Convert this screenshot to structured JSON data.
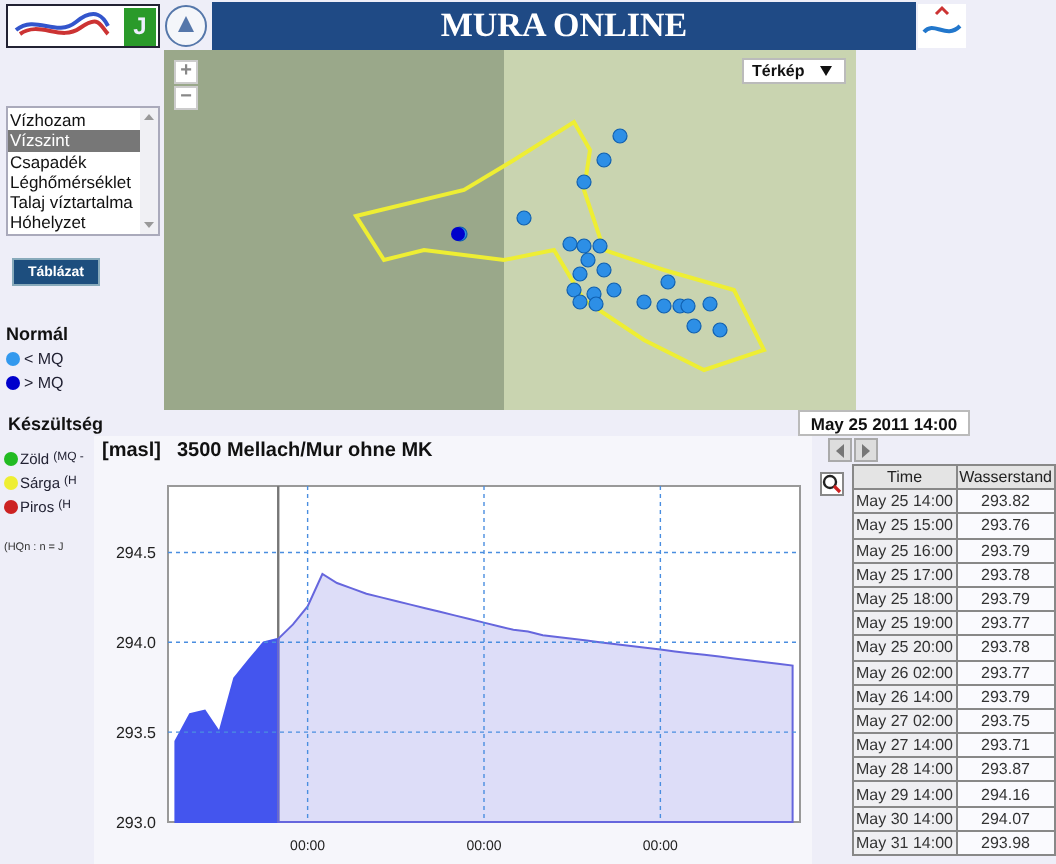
{
  "header": {
    "logo_letter": "J",
    "title": "MURA ONLINE"
  },
  "sidebar": {
    "list": [
      {
        "label": "Vízhozam",
        "selected": false
      },
      {
        "label": "Vízszint",
        "selected": true
      },
      {
        "label": "Csapadék",
        "selected": false
      },
      {
        "label": "Léghőmérséklet",
        "selected": false
      },
      {
        "label": "Talaj víztartalma",
        "selected": false
      },
      {
        "label": "Hóhelyzet",
        "selected": false
      }
    ],
    "table_button": "Táblázat",
    "legend_normal": {
      "title": "Normál",
      "items": [
        {
          "label": "< MQ",
          "color": "#3399ee"
        },
        {
          "label": "> MQ",
          "color": "#0000cc"
        }
      ]
    },
    "legend_alert": {
      "title": "Készültség",
      "items": [
        {
          "label": "Zöld",
          "note": "(MQ -",
          "color": "#22bb22"
        },
        {
          "label": "Sárga",
          "note": "(H",
          "color": "#eeee33"
        },
        {
          "label": "Piros",
          "note": "(H",
          "color": "#cc2222"
        }
      ],
      "footnote": "(HQn : n = J"
    }
  },
  "map": {
    "zoom_in": "+",
    "zoom_out": "−",
    "map_type": "Térkép",
    "date": "May 25 2011 14:00"
  },
  "chart": {
    "unit": "[masl]",
    "title": "3500 Mellach/Mur ohne MK",
    "chart_data": {
      "type": "area",
      "categories": [
        null,
        null,
        null,
        null,
        null,
        null,
        null,
        null,
        null,
        "00:00",
        null,
        null,
        null,
        null,
        null,
        null,
        null,
        null,
        null,
        null,
        null,
        "00:00",
        null,
        null,
        null,
        null,
        null,
        null,
        null,
        null,
        null,
        null,
        null,
        "00:00",
        null,
        null,
        null,
        null,
        null,
        null,
        null,
        null,
        null
      ],
      "series": [
        {
          "color": "#4455ee",
          "values": [
            293.45,
            293.6,
            293.62,
            293.5,
            293.8,
            293.9,
            294.0,
            294.02,
            null,
            null,
            null,
            null,
            null,
            null,
            null,
            null,
            null,
            null,
            null,
            null,
            null,
            null,
            null,
            null,
            null,
            null,
            null,
            null,
            null,
            null,
            null,
            null,
            null,
            null,
            null,
            null,
            null,
            null,
            null,
            null,
            null,
            null,
            null
          ]
        },
        {
          "color": "#6666dd",
          "values": [
            null,
            null,
            null,
            null,
            null,
            null,
            null,
            294.02,
            294.1,
            294.2,
            294.38,
            294.33,
            294.3,
            294.27,
            294.25,
            294.23,
            294.21,
            294.19,
            294.17,
            294.15,
            294.13,
            294.11,
            294.09,
            294.07,
            294.06,
            294.04,
            294.03,
            294.02,
            294.01,
            294.0,
            293.99,
            293.98,
            293.97,
            293.96,
            293.95,
            293.94,
            293.93,
            293.92,
            293.91,
            293.9,
            293.89,
            293.88,
            293.87
          ]
        }
      ],
      "ylim": [
        293.0,
        294.87
      ],
      "grid": true,
      "yticks": [
        {
          "value": 293.0,
          "label": "293.0"
        },
        {
          "value": 293.5,
          "label": "293.5"
        },
        {
          "value": 294.0,
          "label": "294.0"
        },
        {
          "value": 294.5,
          "label": "294.5"
        }
      ]
    }
  },
  "table": {
    "columns": [
      "Time",
      "Wasserstand"
    ],
    "rows": [
      [
        "May 25 14:00",
        "293.82"
      ],
      [
        "May 25 15:00",
        "293.76"
      ],
      [
        "May 25 16:00",
        "293.79"
      ],
      [
        "May 25 17:00",
        "293.78"
      ],
      [
        "May 25 18:00",
        "293.79"
      ],
      [
        "May 25 19:00",
        "293.77"
      ],
      [
        "May 25 20:00",
        "293.78"
      ],
      [
        "May 26 02:00",
        "293.77"
      ],
      [
        "May 26 14:00",
        "293.79"
      ],
      [
        "May 27 02:00",
        "293.75"
      ],
      [
        "May 27 14:00",
        "293.71"
      ],
      [
        "May 28 14:00",
        "293.87"
      ],
      [
        "May 29 14:00",
        "294.16"
      ],
      [
        "May 30 14:00",
        "294.07"
      ],
      [
        "May 31 14:00",
        "293.98"
      ]
    ]
  }
}
